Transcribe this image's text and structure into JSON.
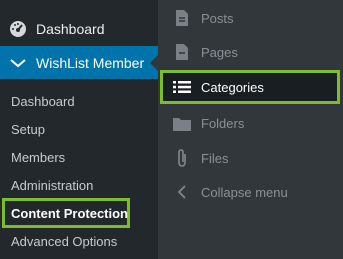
{
  "sidebar": {
    "dashboard": {
      "label": "Dashboard",
      "icon": "dashboard-gauge-icon"
    },
    "wishlist": {
      "label": "WishList Member",
      "icon": "wishlist-check-icon"
    },
    "submenu": [
      {
        "label": "Dashboard"
      },
      {
        "label": "Setup"
      },
      {
        "label": "Members"
      },
      {
        "label": "Administration"
      },
      {
        "label": "Content Protection"
      },
      {
        "label": "Advanced Options"
      }
    ]
  },
  "flyout": {
    "items": [
      {
        "label": "Posts",
        "icon": "document-icon"
      },
      {
        "label": "Pages",
        "icon": "page-icon"
      },
      {
        "label": "Categories",
        "icon": "list-icon"
      },
      {
        "label": "Folders",
        "icon": "folder-icon"
      },
      {
        "label": "Files",
        "icon": "paperclip-icon"
      },
      {
        "label": "Collapse menu",
        "icon": "chevron-left-icon"
      }
    ]
  },
  "colors": {
    "sidebar_bg": "#23282d",
    "flyout_bg": "#32373c",
    "active_blue": "#0073aa",
    "highlight_green": "#7cbd2a"
  }
}
